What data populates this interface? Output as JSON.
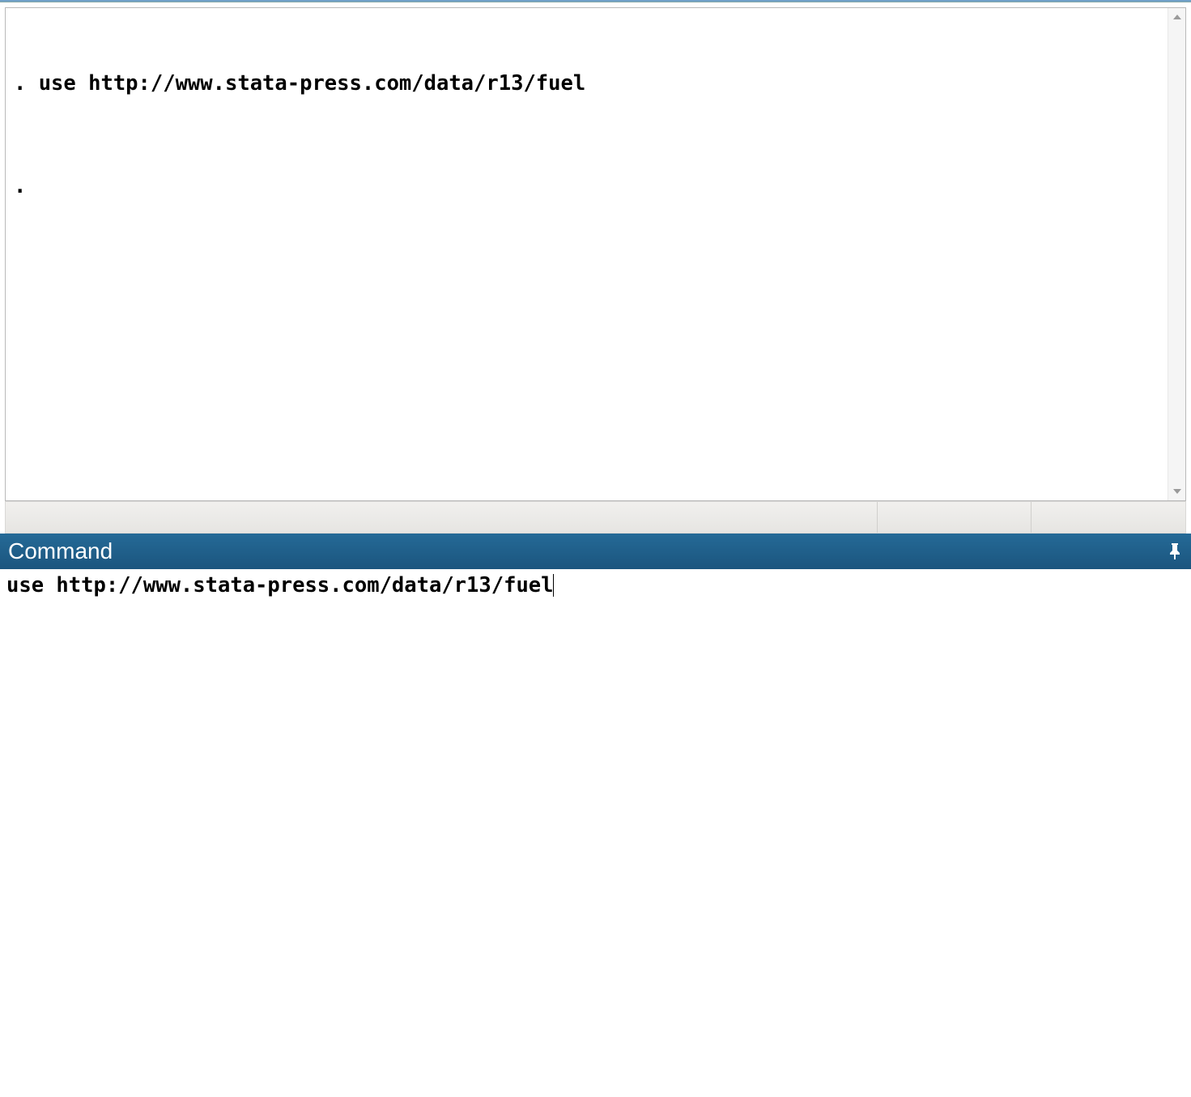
{
  "results": {
    "line1": ". use http://www.stata-press.com/data/r13/fuel",
    "line2": "."
  },
  "command_panel": {
    "title": "Command",
    "input_value": "use http://www.stata-press.com/data/r13/fuel"
  },
  "icons": {
    "pin": "pin-icon",
    "scroll_up": "▲",
    "scroll_down": "▾"
  }
}
